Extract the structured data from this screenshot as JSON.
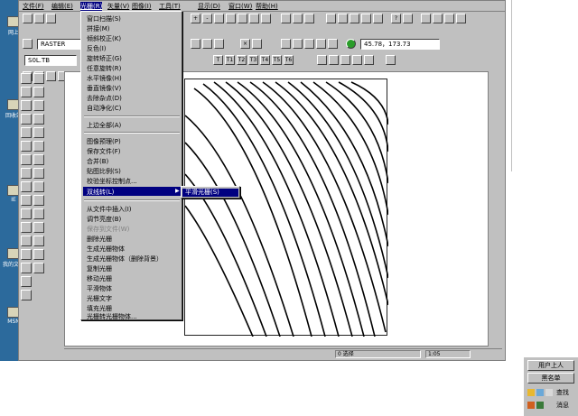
{
  "desktop": {
    "icons": [
      {
        "label": "网上"
      },
      {
        "label": "回收站"
      },
      {
        "label": "IE"
      },
      {
        "label": "我的文档"
      },
      {
        "label": "MSN"
      }
    ]
  },
  "menubar": {
    "items": [
      "文件(F)",
      "编辑(E)",
      "光栅(R)",
      "矢量(V)",
      "图像(I)",
      "工具(T)",
      "显示(D)",
      "窗口(W)",
      "帮助(H)"
    ]
  },
  "toolbar": {
    "layer_field": "RASTER",
    "file_field": "S0L.TB",
    "coord_field": "45.78，173.73"
  },
  "dropdown": {
    "items": [
      "窗口扫描(S)",
      "拼接(M)",
      "倾斜校正(K)",
      "反色(I)",
      "旋转矫正(G)",
      "任意旋转(R)",
      "水平镜像(H)",
      "垂直镜像(V)",
      "去除杂点(D)",
      "自动净化(C)",
      "上边全部(A)",
      "图像预理(P)",
      "保存文件(F)",
      "合并(B)",
      "贴图比例(S)",
      "校验坐标控制点...",
      "双线转(L)",
      "从文件中插入(I)",
      "调节亮度(B)",
      "保存到文件(W)",
      "删除光栅",
      "生成光栅物体",
      "生成光栅物体（删除背景）",
      "复制光栅",
      "移动光栅",
      "平滑物体",
      "光栅文字",
      "填充光栅",
      "光栅转光栅物体..."
    ],
    "highlighted": "双线转(L)",
    "submenu_item": "平滑光栅(S)"
  },
  "statusbar": {
    "selection": "0 选择",
    "scale": "1:05"
  },
  "tray": {
    "buttons": [
      "用户上人",
      "黑名单"
    ],
    "actions": [
      "查找",
      "消息"
    ]
  }
}
